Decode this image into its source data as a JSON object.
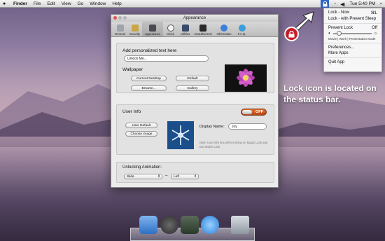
{
  "menubar": {
    "app_name": "Finder",
    "items": [
      "File",
      "Edit",
      "View",
      "Go",
      "Window",
      "Help"
    ],
    "clock": "Tue 5:40 PM"
  },
  "dropdown": {
    "lock_now": "Lock - Now",
    "lock_now_shortcut": "⌘L",
    "lock_prevent_sleep": "Lock - with Prevent Sleep",
    "prevent_lock": "Prevent Lock",
    "prevent_lock_state": "Off",
    "slider_value_fraction": 0.1,
    "modes": "Movie | Work | Presentation Mode",
    "preferences": "Preferences...",
    "more_apps": "More Apps",
    "quit": "Quit App"
  },
  "caption": "Lock icon is located on the status bar.",
  "window": {
    "title": "Appearance",
    "toolbar": [
      {
        "label": "General",
        "icon": "switch-icon"
      },
      {
        "label": "Security",
        "icon": "lock-icon"
      },
      {
        "label": "Appearance",
        "icon": "appearance-icon"
      },
      {
        "label": "Clock",
        "icon": "clock-icon"
      },
      {
        "label": "Utilities",
        "icon": "utilities-icon"
      },
      {
        "label": "Unauthorized",
        "icon": "spy-icon"
      },
      {
        "label": "Information",
        "icon": "info-icon"
      },
      {
        "label": "F.A.Q.",
        "icon": "question-icon"
      }
    ],
    "personalized": {
      "heading": "Add personalized text here",
      "text_value": "Unlock Me..."
    },
    "wallpaper": {
      "heading": "Wallpaper",
      "current_desktop": "Current Desktop",
      "default": "Default",
      "browse": "Browse...",
      "gallery": "Gallery"
    },
    "user_info": {
      "heading": "User Info",
      "toggle": "OFF",
      "user_default": "User Default",
      "choose_image": "Choose image",
      "display_name_label": "Display Name:",
      "display_name_value": "Joy",
      "note": "Note: User info box will not show on Magic Lock and Dot Watch Lock"
    },
    "animation": {
      "heading": "Unlocking Animation:",
      "style": "Slide",
      "separator": "–",
      "direction": "Left"
    }
  },
  "colors": {
    "accent_orange": "#d9622a",
    "status_blue": "#2d64c8",
    "badge_red": "#c91f2a"
  }
}
